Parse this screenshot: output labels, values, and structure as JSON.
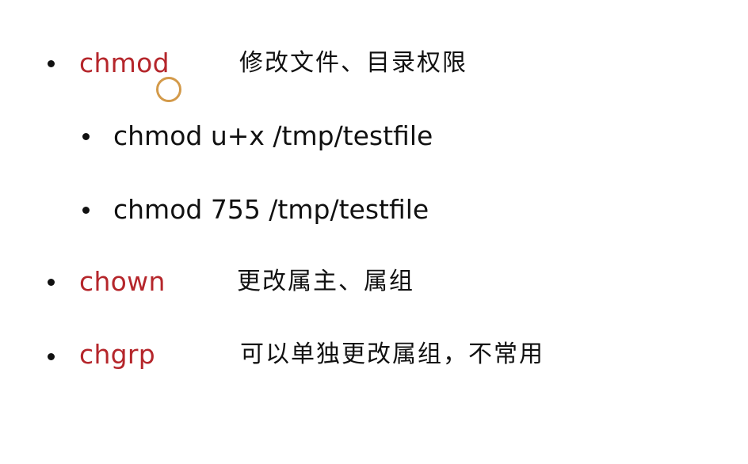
{
  "items": [
    {
      "command": "chmod",
      "description": "修改文件、目录权限",
      "subitems": [
        {
          "text": "chmod u+x /tmp/testfile"
        },
        {
          "text": "chmod 755 /tmp/testfile"
        }
      ]
    },
    {
      "command": "chown",
      "description": "更改属主、属组"
    },
    {
      "command": "chgrp",
      "description": "可以单独更改属组，不常用"
    }
  ],
  "colors": {
    "command": "#b5262b",
    "text": "#111111",
    "cursor_ring": "#d39a4a"
  }
}
